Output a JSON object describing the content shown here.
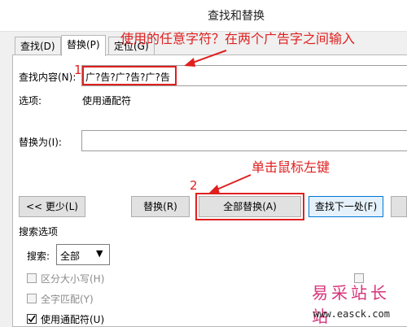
{
  "window": {
    "title": "查找和替换"
  },
  "tabs": [
    {
      "label": "查找(D)"
    },
    {
      "label": "替换(P)"
    },
    {
      "label": "定位(G)"
    }
  ],
  "find": {
    "label": "查找内容(N):",
    "value": "广?告?广?告?广?告"
  },
  "options": {
    "label": "选项:",
    "value": "使用通配符"
  },
  "replace": {
    "label": "替换为(I):",
    "value": ""
  },
  "buttons": {
    "less": "<< 更少(L)",
    "replace": "替换(R)",
    "replace_all": "全部替换(A)",
    "find_next": "查找下一处(F)"
  },
  "search_options": {
    "header": "搜索选项",
    "search_label": "搜索:",
    "search_value": "全部",
    "match_case": "区分大小写(H)",
    "whole_word": "全字匹配(Y)",
    "use_wildcards": "使用通配符(U)"
  },
  "annotations": {
    "step1": "1",
    "step2": "2",
    "note1": "使用的任意字符？在两个广告字之间输入",
    "note2": "单击鼠标左键"
  },
  "watermark": {
    "text": "易采站长站",
    "url": "www.easck.com"
  },
  "colors": {
    "annotation_red": "#e02020",
    "accent_blue": "#0078d7",
    "watermark_pink": "#d6337a"
  }
}
